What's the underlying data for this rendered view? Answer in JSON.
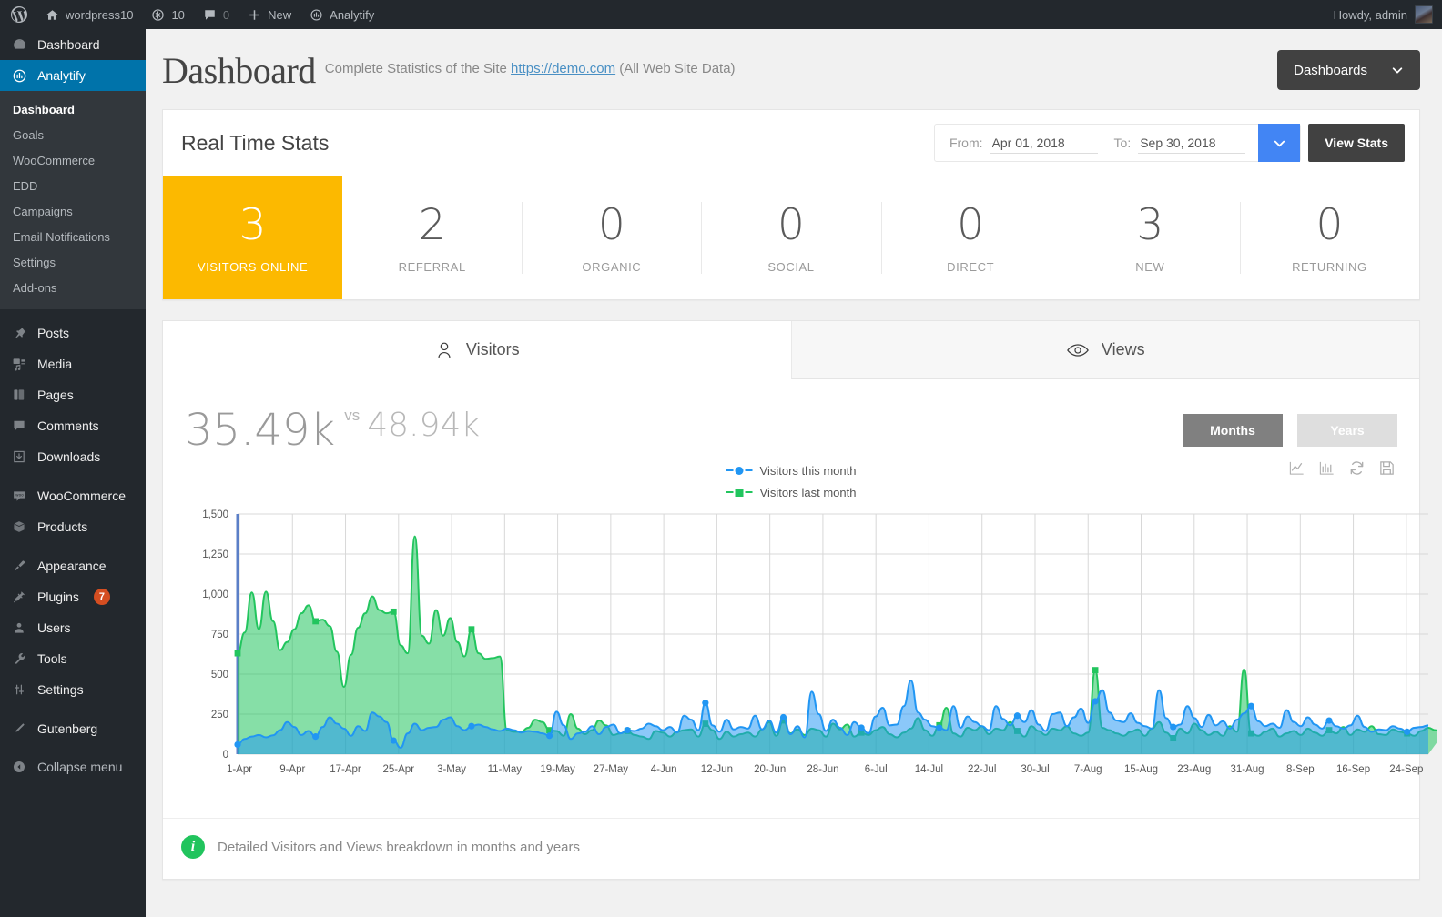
{
  "adminbar": {
    "site_name": "wordpress10",
    "updates_count": "10",
    "comments_count": "0",
    "new_label": "New",
    "analytify_label": "Analytify",
    "howdy": "Howdy, admin"
  },
  "sidebar": {
    "items": [
      {
        "label": "Dashboard",
        "icon": "dashboard-icon",
        "current": false
      },
      {
        "label": "Analytify",
        "icon": "analytify-icon",
        "current": true
      }
    ],
    "submenu": [
      {
        "label": "Dashboard",
        "current": true
      },
      {
        "label": "Goals",
        "current": false
      },
      {
        "label": "WooCommerce",
        "current": false
      },
      {
        "label": "EDD",
        "current": false
      },
      {
        "label": "Campaigns",
        "current": false
      },
      {
        "label": "Email Notifications",
        "current": false
      },
      {
        "label": "Settings",
        "current": false
      },
      {
        "label": "Add-ons",
        "current": false
      }
    ],
    "group2": [
      {
        "label": "Posts",
        "icon": "pin-icon"
      },
      {
        "label": "Media",
        "icon": "media-icon"
      },
      {
        "label": "Pages",
        "icon": "pages-icon"
      },
      {
        "label": "Comments",
        "icon": "comment-icon"
      },
      {
        "label": "Downloads",
        "icon": "download-icon"
      }
    ],
    "group3": [
      {
        "label": "WooCommerce",
        "icon": "woocommerce-icon"
      },
      {
        "label": "Products",
        "icon": "products-icon"
      }
    ],
    "group4": [
      {
        "label": "Appearance",
        "icon": "brush-icon",
        "badge": ""
      },
      {
        "label": "Plugins",
        "icon": "plug-icon",
        "badge": "7"
      },
      {
        "label": "Users",
        "icon": "user-icon",
        "badge": ""
      },
      {
        "label": "Tools",
        "icon": "wrench-icon",
        "badge": ""
      },
      {
        "label": "Settings",
        "icon": "sliders-icon",
        "badge": ""
      }
    ],
    "group5": [
      {
        "label": "Gutenberg",
        "icon": "pencil-icon"
      }
    ],
    "collapse_label": "Collapse menu"
  },
  "header": {
    "title": "Dashboard",
    "subtitle_pre": "Complete Statistics of the Site",
    "site_link": "https://demo.com",
    "subtitle_post": "(All Web Site Data)",
    "dashboards_button": "Dashboards"
  },
  "realtime": {
    "title": "Real Time Stats",
    "from_label": "From:",
    "from_value": "Apr 01, 2018",
    "to_label": "To:",
    "to_value": "Sep 30, 2018",
    "view_stats_button": "View Stats",
    "highlight_color": "#fcb900",
    "cards": [
      {
        "value": "3",
        "label": "VISITORS ONLINE",
        "highlight": true
      },
      {
        "value": "2",
        "label": "REFERRAL",
        "highlight": false
      },
      {
        "value": "0",
        "label": "ORGANIC",
        "highlight": false
      },
      {
        "value": "0",
        "label": "SOCIAL",
        "highlight": false
      },
      {
        "value": "0",
        "label": "DIRECT",
        "highlight": false
      },
      {
        "value": "3",
        "label": "NEW",
        "highlight": false
      },
      {
        "value": "0",
        "label": "RETURNING",
        "highlight": false
      }
    ]
  },
  "chart_panel": {
    "tabs": [
      {
        "label": "Visitors",
        "icon": "person-icon",
        "active": true
      },
      {
        "label": "Views",
        "icon": "eye-icon",
        "active": false
      }
    ],
    "current_total": "35.49k",
    "vs_label": "vs",
    "previous_total": "48.94k",
    "range_buttons": [
      {
        "label": "Months",
        "active": true
      },
      {
        "label": "Years",
        "active": false
      }
    ],
    "tools": [
      {
        "name": "line-chart-icon"
      },
      {
        "name": "bar-chart-icon"
      },
      {
        "name": "refresh-icon"
      },
      {
        "name": "save-icon"
      }
    ],
    "note": "Detailed Visitors and Views breakdown in months and years"
  },
  "chart_data": {
    "type": "area",
    "title": "",
    "xlabel": "",
    "ylabel": "",
    "ylim": [
      0,
      1500
    ],
    "yticks": [
      "0",
      "250",
      "500",
      "750",
      "1,000",
      "1,250",
      "1,500"
    ],
    "grid": true,
    "legend_position": "top-center",
    "colors": {
      "this_month": "#2196f3",
      "last_month": "#22c55e"
    },
    "xticks": [
      "1-Apr",
      "9-Apr",
      "17-Apr",
      "25-Apr",
      "3-May",
      "11-May",
      "19-May",
      "27-May",
      "4-Jun",
      "12-Jun",
      "20-Jun",
      "28-Jun",
      "6-Jul",
      "14-Jul",
      "22-Jul",
      "30-Jul",
      "7-Aug",
      "15-Aug",
      "23-Aug",
      "31-Aug",
      "8-Sep",
      "16-Sep",
      "24-Sep"
    ],
    "series": [
      {
        "name": "Visitors this month",
        "marker": "circle",
        "color": "#2196f3",
        "values": [
          60,
          95,
          110,
          120,
          105,
          118,
          150,
          200,
          170,
          120,
          145,
          110,
          170,
          230,
          190,
          160,
          115,
          175,
          145,
          260,
          235,
          200,
          85,
          40,
          130,
          190,
          150,
          165,
          170,
          215,
          230,
          175,
          150,
          175,
          185,
          170,
          155,
          145,
          160,
          150,
          135,
          145,
          140,
          130,
          115,
          265,
          180,
          95,
          130,
          140,
          175,
          125,
          170,
          185,
          130,
          150,
          145,
          160,
          190,
          175,
          150,
          170,
          135,
          240,
          215,
          150,
          320,
          180,
          140,
          215,
          155,
          170,
          160,
          240,
          155,
          210,
          135,
          230,
          125,
          175,
          105,
          390,
          250,
          145,
          215,
          165,
          120,
          200,
          165,
          130,
          235,
          290,
          180,
          185,
          300,
          460,
          260,
          215,
          175,
          165,
          150,
          300,
          165,
          235,
          200,
          175,
          150,
          300,
          220,
          180,
          240,
          200,
          275,
          185,
          145,
          250,
          260,
          175,
          230,
          285,
          195,
          330,
          400,
          260,
          210,
          200,
          255,
          195,
          175,
          160,
          400,
          225,
          170,
          185,
          300,
          225,
          170,
          245,
          180,
          205,
          160,
          215,
          255,
          300,
          205,
          175,
          190,
          165,
          275,
          200,
          175,
          230,
          185,
          160,
          210,
          175,
          160,
          180,
          240,
          170,
          140,
          155,
          150,
          175,
          160,
          140,
          165,
          170,
          180
        ]
      },
      {
        "name": "Visitors last month",
        "marker": "square",
        "color": "#22c55e",
        "values": [
          630,
          760,
          1010,
          780,
          1015,
          830,
          650,
          700,
          780,
          880,
          930,
          830,
          840,
          800,
          640,
          420,
          620,
          790,
          880,
          985,
          900,
          880,
          890,
          680,
          630,
          1360,
          740,
          690,
          900,
          740,
          850,
          700,
          610,
          780,
          630,
          595,
          600,
          610,
          150,
          140,
          140,
          165,
          215,
          200,
          150,
          145,
          115,
          250,
          160,
          125,
          150,
          210,
          180,
          120,
          130,
          145,
          120,
          110,
          95,
          145,
          135,
          110,
          140,
          150,
          155,
          110,
          190,
          150,
          95,
          140,
          110,
          125,
          135,
          110,
          155,
          200,
          115,
          210,
          130,
          155,
          120,
          160,
          150,
          110,
          190,
          155,
          185,
          110,
          135,
          120,
          150,
          170,
          125,
          105,
          135,
          160,
          225,
          150,
          115,
          180,
          290,
          130,
          110,
          165,
          150,
          175,
          125,
          160,
          150,
          200,
          145,
          110,
          175,
          145,
          120,
          160,
          150,
          175,
          130,
          115,
          135,
          525,
          165,
          150,
          130,
          115,
          140,
          155,
          115,
          160,
          200,
          135,
          100,
          160,
          130,
          190,
          150,
          120,
          140,
          115,
          175,
          140,
          530,
          130,
          115,
          140,
          160,
          110,
          130,
          145,
          120,
          160,
          135,
          115,
          150,
          130,
          170,
          120,
          155,
          140,
          175,
          125,
          120,
          155,
          140,
          130,
          115,
          145,
          165,
          150,
          120
        ]
      }
    ]
  }
}
